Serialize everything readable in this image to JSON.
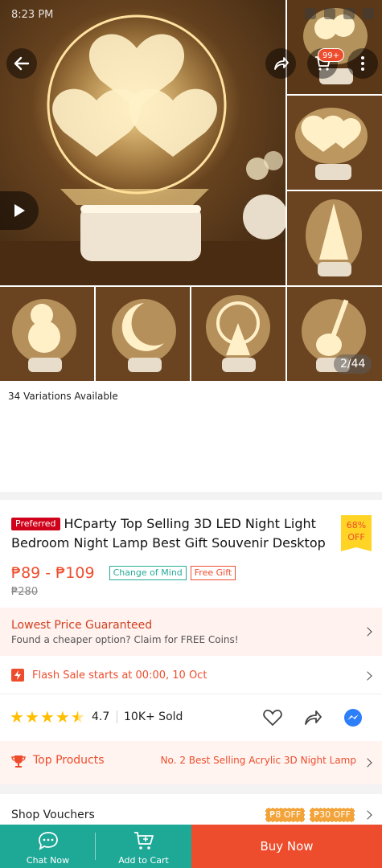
{
  "status_bar": {
    "time": "8:23 PM"
  },
  "gallery": {
    "counter": "2/44",
    "cart_badge": "99+"
  },
  "variations_text": "34 Variations Available",
  "product": {
    "preferred_badge": "Preferred",
    "title": "HCparty Top Selling 3D LED Night Light Bedroom Night Lamp Best Gift Souvenir Desktop",
    "discount": {
      "percent": "68%",
      "label": "OFF"
    },
    "price_range": "₱89 - ₱109",
    "chips": [
      "Change of Mind",
      "Free Gift"
    ],
    "original_price": "₱280"
  },
  "guarantee": {
    "title": "Lowest Price Guaranteed",
    "subtitle": "Found a cheaper option? Claim for FREE Coins!"
  },
  "flash_sale": {
    "text": "Flash Sale starts at 00:00, 10 Oct"
  },
  "rating": {
    "value": "4.7",
    "stars": 4.5,
    "sold": "10K+ Sold"
  },
  "top_products": {
    "label": "Top Products",
    "value": "No. 2 Best Selling Acrylic 3D Night Lamp"
  },
  "vouchers": {
    "label": "Shop Vouchers",
    "tags": [
      "₱8 OFF",
      "₱30 OFF"
    ]
  },
  "bottom_bar": {
    "chat": "Chat Now",
    "cart": "Add to Cart",
    "buy": "Buy Now"
  },
  "colors": {
    "accent": "#ee4d2d",
    "teal": "#1ea896",
    "star": "#ffbf00",
    "badge_yellow": "#ffd424"
  }
}
